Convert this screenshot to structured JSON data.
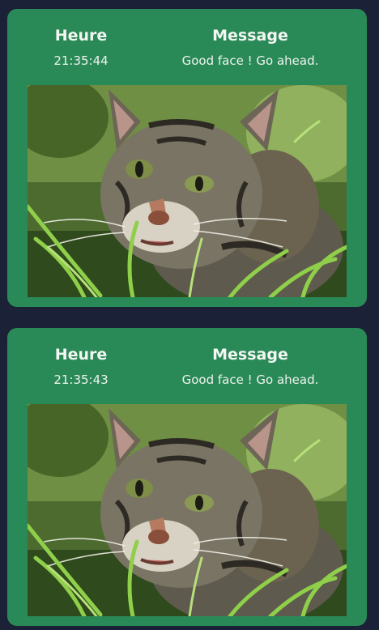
{
  "detections": [
    {
      "time_header": "Heure",
      "time_value": "21:35:44",
      "message_header": "Message",
      "message_value": "Good face ! Go ahead.",
      "image": "tabby-cat-in-grass"
    },
    {
      "time_header": "Heure",
      "time_value": "21:35:43",
      "message_header": "Message",
      "message_value": "Good face ! Go ahead.",
      "image": "tabby-cat-in-grass"
    }
  ],
  "colors": {
    "background": "#1b2136",
    "card": "#2a8a57",
    "text": "#f3f6f3"
  }
}
